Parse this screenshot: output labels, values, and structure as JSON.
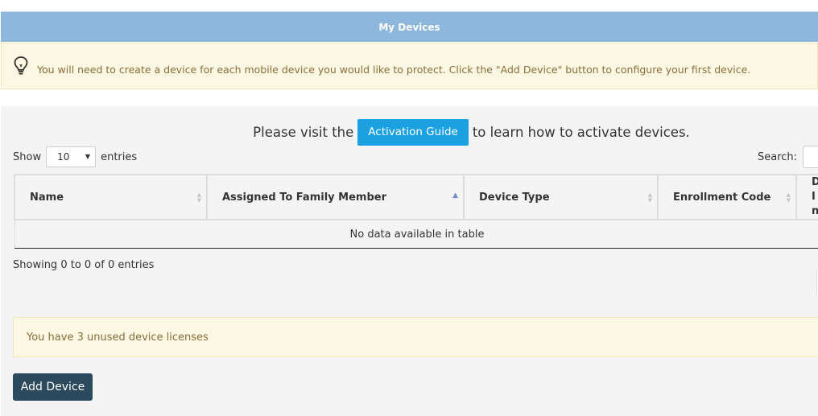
{
  "header": {
    "title": "My Devices"
  },
  "info_banner": {
    "icon": "lightbulb-icon",
    "text": "You will need to create a device for each mobile device you would like to protect. Click the \"Add Device\" button to configure your first device."
  },
  "guide": {
    "prefix": "Please visit the",
    "button_label": "Activation Guide",
    "suffix": "to learn how to activate devices."
  },
  "length_menu": {
    "show_label": "Show",
    "selected": "10",
    "entries_label": "entries"
  },
  "search": {
    "label": "Search:",
    "value": ""
  },
  "table": {
    "columns": [
      {
        "label": "Name",
        "sort": "none"
      },
      {
        "label": "Assigned To Family Member",
        "sort": "ascending"
      },
      {
        "label": "Device Type",
        "sort": "none"
      },
      {
        "label": "Enrollment Code",
        "sort": "none"
      },
      {
        "label": "D In",
        "sort": "none"
      }
    ],
    "empty_message": "No data available in table"
  },
  "info_text": "Showing 0 to 0 of 0 entries",
  "license_banner": {
    "text": "You have 3 unused device licenses"
  },
  "add_button": {
    "label": "Add Device"
  },
  "colors": {
    "header_bg": "#8db7dc",
    "warning_bg": "#fcf8e3",
    "warning_text": "#8a6d3b",
    "guide_button": "#1ba1e2",
    "add_button": "#2b4a5e"
  }
}
